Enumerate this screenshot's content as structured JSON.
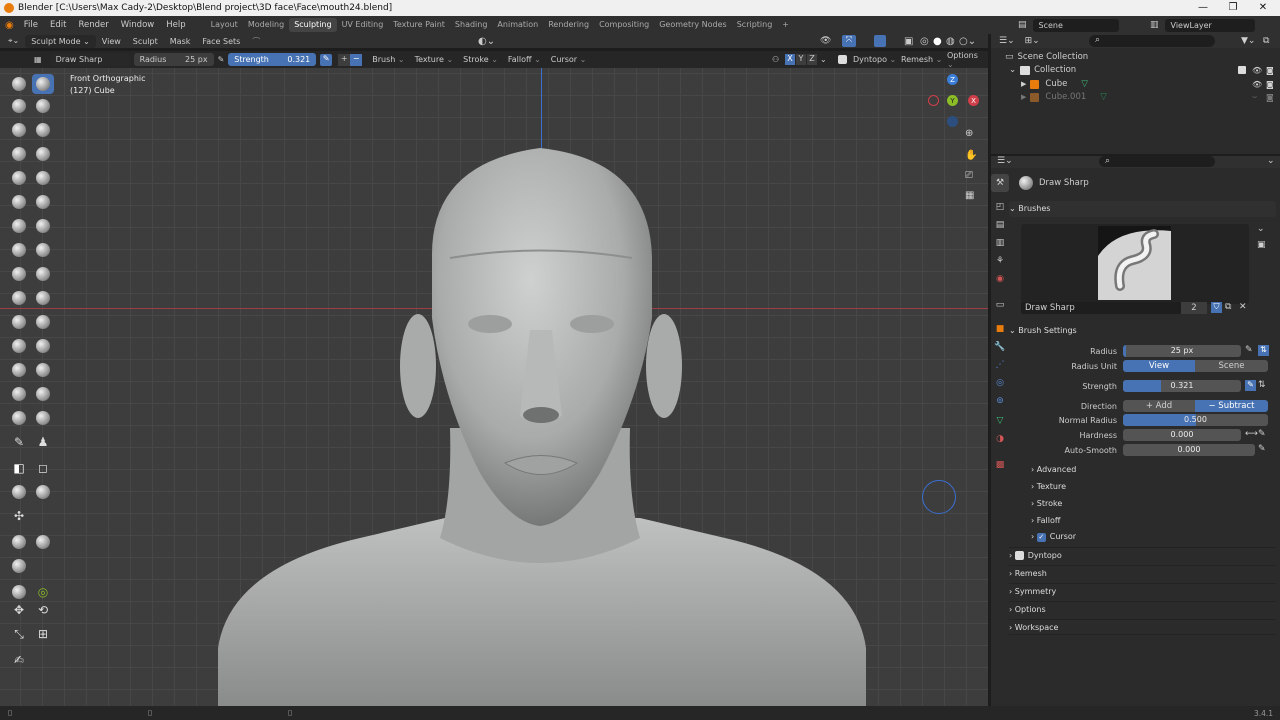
{
  "window": {
    "title": "Blender [C:\\Users\\Max Cady-2\\Desktop\\Blend project\\3D face\\Face\\mouth24.blend]"
  },
  "menu": [
    "File",
    "Edit",
    "Render",
    "Window",
    "Help"
  ],
  "workspaces": [
    "Layout",
    "Modeling",
    "Sculpting",
    "UV Editing",
    "Texture Paint",
    "Shading",
    "Animation",
    "Rendering",
    "Compositing",
    "Geometry Nodes",
    "Scripting"
  ],
  "active_workspace": "Sculpting",
  "scene": {
    "label": "Scene",
    "view_layer": "ViewLayer"
  },
  "header": {
    "mode": "Sculpt Mode",
    "menus": [
      "View",
      "Sculpt",
      "Mask",
      "Face Sets"
    ],
    "right": {
      "dyntopo": "Dyntopo",
      "remesh": "Remesh",
      "options": "Options",
      "axes": [
        "X",
        "Y",
        "Z"
      ]
    }
  },
  "toolsettings": {
    "brush": "Draw Sharp",
    "radius_label": "Radius",
    "radius": "25 px",
    "strength_label": "Strength",
    "strength": "0.321",
    "menus": [
      "Brush",
      "Texture",
      "Stroke",
      "Falloff",
      "Cursor"
    ]
  },
  "viewport": {
    "view": "Front Orthographic",
    "object": "(127) Cube"
  },
  "outliner": {
    "root": "Scene Collection",
    "collection": "Collection",
    "items": [
      "Cube",
      "Cube.001"
    ]
  },
  "properties": {
    "brush_name": "Draw Sharp",
    "brushes_section": "Brushes",
    "brush_field": "Draw Sharp",
    "brush_users": "2",
    "brush_settings": "Brush Settings",
    "radius_label": "Radius",
    "radius": "25 px",
    "radius_unit_label": "Radius Unit",
    "radius_unit": [
      "View",
      "Scene"
    ],
    "strength_label": "Strength",
    "strength": "0.321",
    "strength_fraction": 0.321,
    "direction_label": "Direction",
    "direction": [
      "Add",
      "Subtract"
    ],
    "normal_radius_label": "Normal Radius",
    "normal_radius": "0.500",
    "normal_radius_fraction": 0.5,
    "hardness_label": "Hardness",
    "hardness": "0.000",
    "autosmooth_label": "Auto-Smooth",
    "autosmooth": "0.000",
    "subsections": [
      "Advanced",
      "Texture",
      "Stroke",
      "Falloff",
      "Cursor"
    ],
    "sections": [
      "Dyntopo",
      "Remesh",
      "Symmetry",
      "Options",
      "Workspace"
    ]
  },
  "status": {
    "version": "3.4.1"
  },
  "colors": {
    "accent": "#4772b3",
    "orange": "#e87d0d",
    "x_axis": "#cf3f4a",
    "y_axis": "#8cbd26",
    "z_axis": "#3b7ed8"
  }
}
